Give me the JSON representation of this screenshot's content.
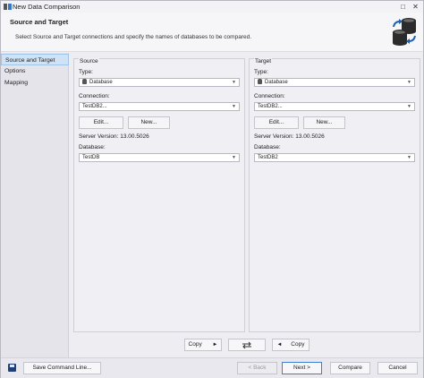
{
  "window": {
    "title": "New Data Comparison",
    "maximize_glyph": "□",
    "close_glyph": "✕"
  },
  "header": {
    "title": "Source and Target",
    "description": "Select Source and Target connections and specify the names of databases to be compared.",
    "icon": "database-sync-icon"
  },
  "sidebar": {
    "items": [
      {
        "label": "Source and Target",
        "selected": true
      },
      {
        "label": "Options",
        "selected": false
      },
      {
        "label": "Mapping",
        "selected": false
      }
    ]
  },
  "source": {
    "title": "Source",
    "type_label": "Type:",
    "type_value": "Database",
    "connection_label": "Connection:",
    "connection_value": "TestDB2...",
    "edit_label": "Edit...",
    "new_label": "New...",
    "server_version": "Server Version: 13.00.5026",
    "database_label": "Database:",
    "database_value": "TestDB"
  },
  "target": {
    "title": "Target",
    "type_label": "Type:",
    "type_value": "Database",
    "connection_label": "Connection:",
    "connection_value": "TestDB2...",
    "edit_label": "Edit...",
    "new_label": "New...",
    "server_version": "Server Version: 13.00.5026",
    "database_label": "Database:",
    "database_value": "TestDB2"
  },
  "copy_bar": {
    "copy_right_label": "Copy",
    "copy_left_label": "Copy",
    "swap_icon": "swap-icon"
  },
  "footer": {
    "save_label": "Save Command Line...",
    "back_label": "< Back",
    "next_label": "Next >",
    "compare_label": "Compare",
    "cancel_label": "Cancel"
  },
  "colors": {
    "selection_bg": "#cfe3f7",
    "primary_border": "#3c7fd0",
    "icon_blue": "#1f5fb0"
  }
}
